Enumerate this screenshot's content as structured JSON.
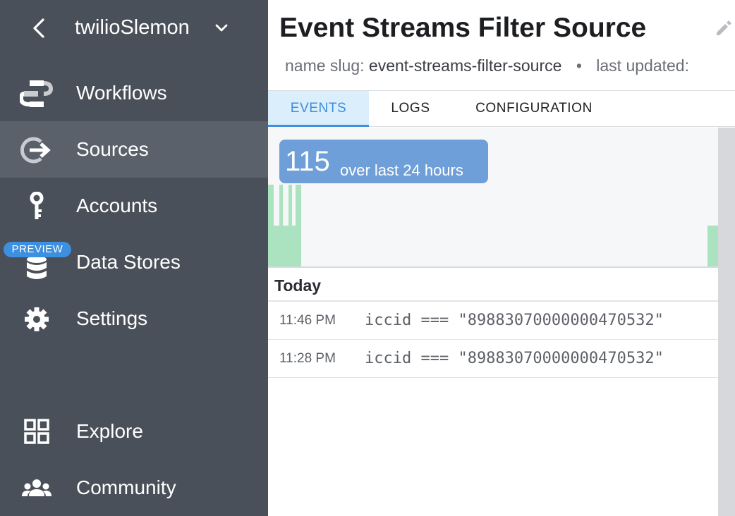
{
  "workspace": {
    "name": "twilioSlemon"
  },
  "sidebar": {
    "items": [
      {
        "label": "Workflows",
        "icon": "workflows-icon"
      },
      {
        "label": "Sources",
        "icon": "sources-icon",
        "active": true
      },
      {
        "label": "Accounts",
        "icon": "key-icon"
      },
      {
        "label": "Data Stores",
        "icon": "database-icon",
        "badge": "PREVIEW"
      },
      {
        "label": "Settings",
        "icon": "gear-icon"
      },
      {
        "label": "Explore",
        "icon": "grid-icon"
      },
      {
        "label": "Community",
        "icon": "people-icon"
      }
    ]
  },
  "page": {
    "title": "Event Streams Filter Source",
    "slug_label": "name slug:",
    "slug_value": "event-streams-filter-source",
    "separator": "•",
    "updated_label": "last updated:"
  },
  "tabs": [
    {
      "label": "EVENTS",
      "active": true
    },
    {
      "label": "LOGS"
    },
    {
      "label": "CONFIGURATION"
    }
  ],
  "summary": {
    "count": "115",
    "period": "over last 24 hours"
  },
  "events": {
    "day": "Today",
    "rows": [
      {
        "time": "11:46 PM",
        "summary": "iccid === \"89883070000000470532\""
      },
      {
        "time": "11:28 PM",
        "summary": "iccid === \"89883070000000470532\""
      }
    ]
  },
  "colors": {
    "sidebar": "#4a5059",
    "sidebar_active": "#5b616a",
    "accent": "#3d8fe0",
    "pill": "#6e9fd8",
    "histogram_bar": "#abe3c1"
  }
}
